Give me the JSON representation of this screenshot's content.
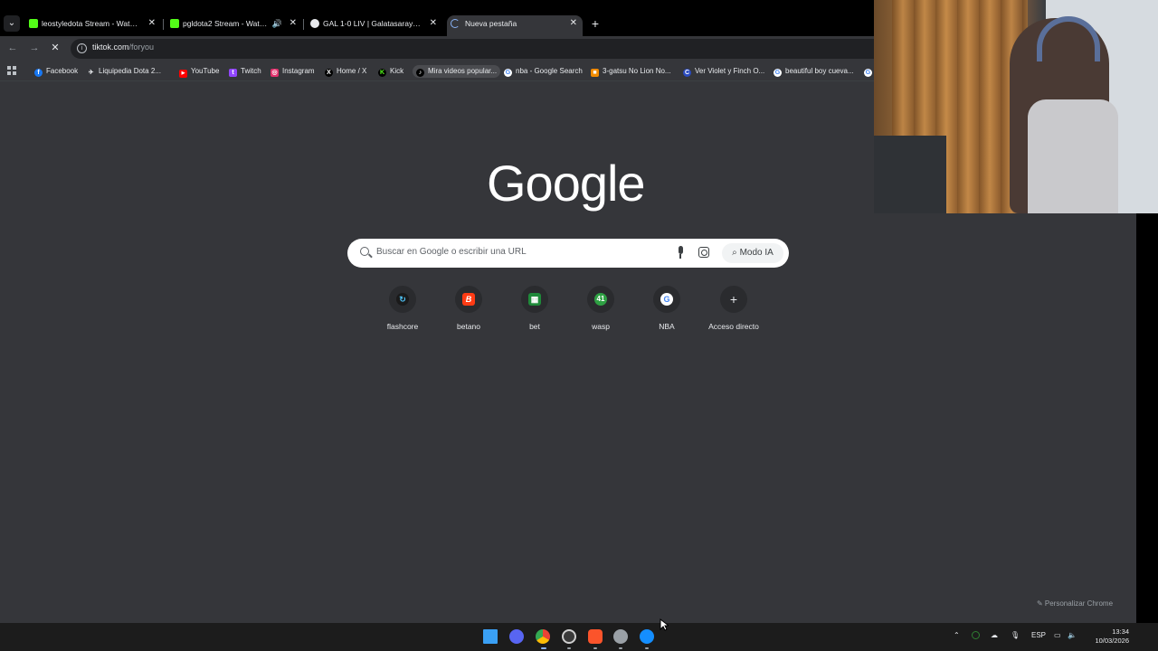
{
  "tabs": [
    {
      "title": "leostyledota Stream - Watch Li…",
      "favicon_color": "#53fc18",
      "audio": false
    },
    {
      "title": "pgldota2 Stream - Watch Li…",
      "favicon_color": "#53fc18",
      "audio": true
    },
    {
      "title": "GAL 1-0 LIV | Galatasaray v Live",
      "favicon_color": "#e8eaed",
      "audio": false
    },
    {
      "title": "Nueva pestaña",
      "favicon_color": "#8ab4f8",
      "audio": false
    }
  ],
  "active_tab": 3,
  "omnibox": {
    "host": "tiktok.com",
    "path": "/foryou"
  },
  "bookmarks": [
    {
      "label": "Facebook",
      "color": "#1877f2",
      "glyph": "f"
    },
    {
      "label": "Liquipedia Dota 2...",
      "color": "#35363a",
      "glyph": "✈"
    },
    {
      "label": "YouTube",
      "color": "#ff0000",
      "glyph": "▶"
    },
    {
      "label": "Twitch",
      "color": "#9146ff",
      "glyph": "t"
    },
    {
      "label": "Instagram",
      "color": "#e1306c",
      "glyph": "◎"
    },
    {
      "label": "Home / X",
      "color": "#000000",
      "glyph": "X"
    },
    {
      "label": "Kick",
      "color": "#53fc18",
      "glyph": "K"
    },
    {
      "label": "Mira videos popular...",
      "color": "#000000",
      "glyph": "♪"
    },
    {
      "label": "nba - Google Search",
      "color": "#4285f4",
      "glyph": "G"
    },
    {
      "label": "3-gatsu No Lion No...",
      "color": "#f28b00",
      "glyph": "■"
    },
    {
      "label": "Ver Violet y Finch O...",
      "color": "#2b4bbf",
      "glyph": "C"
    },
    {
      "label": "beautiful boy cueva...",
      "color": "#4285f4",
      "glyph": "G"
    }
  ],
  "logo_text": "Google",
  "search": {
    "placeholder": "Buscar en Google o escribir una URL",
    "ai_mode_label": "Modo IA"
  },
  "shortcuts": [
    {
      "label": "flashcore",
      "color": "#1a1a1a",
      "glyph": "↻"
    },
    {
      "label": "betano",
      "color": "#ff3b14",
      "glyph": "B"
    },
    {
      "label": "bet",
      "color": "#1f8a3a",
      "glyph": "▦"
    },
    {
      "label": "wasp",
      "color": "#2ea043",
      "glyph": "41"
    },
    {
      "label": "NBA",
      "color": "#ffffff",
      "glyph": "G"
    },
    {
      "label": "Acceso directo",
      "color": "#2a2b2e",
      "glyph": "+"
    }
  ],
  "customize_label": "Personalizar Chrome",
  "taskbar": {
    "apps": [
      {
        "name": "windows-start-icon",
        "color": "#3aa0f5"
      },
      {
        "name": "discord-icon",
        "color": "#5865f2"
      },
      {
        "name": "chrome-icon",
        "color": "#34a853"
      },
      {
        "name": "obs-icon",
        "color": "#3a3a3a"
      },
      {
        "name": "brave-icon",
        "color": "#fb542b"
      },
      {
        "name": "settings-icon",
        "color": "#9aa0a6"
      },
      {
        "name": "battlenet-icon",
        "color": "#148eff"
      }
    ],
    "language": "ESP",
    "time": "13:34",
    "date": "10/03/2026"
  }
}
